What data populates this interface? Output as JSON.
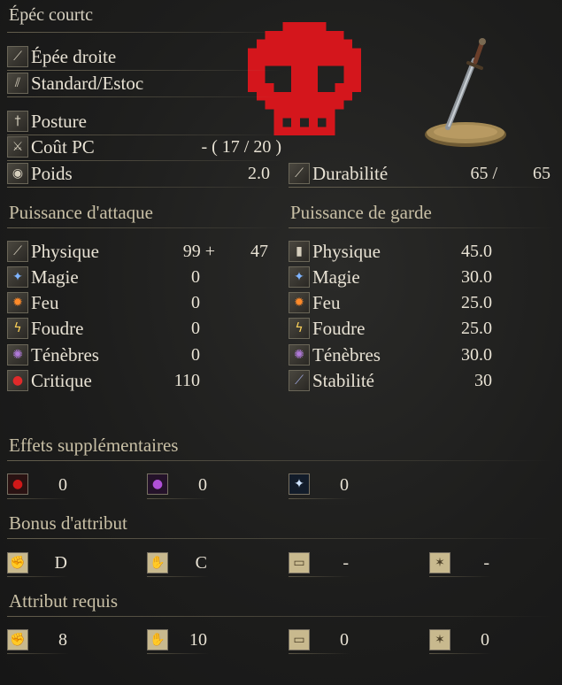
{
  "header": {
    "title": "Épéc courtc"
  },
  "weapon": {
    "type": "Épée droite",
    "attack_type": "Standard/Estoc",
    "skill_label": "Posture",
    "fp_cost_label": "Coût PC",
    "fp_cost_value": "-  (  17 /  20 )",
    "weight_label": "Poids",
    "weight_value": "2.0",
    "durability_label": "Durabilité",
    "durability_current": "65 /",
    "durability_max": "65"
  },
  "attack": {
    "heading": "Puissance d'attaque",
    "rows": [
      {
        "label": "Physique",
        "value": "99 +",
        "bonus": "47",
        "icon": "physical-attack-icon"
      },
      {
        "label": "Magie",
        "value": "0",
        "icon": "magic-icon"
      },
      {
        "label": "Feu",
        "value": "0",
        "icon": "fire-icon"
      },
      {
        "label": "Foudre",
        "value": "0",
        "icon": "lightning-icon"
      },
      {
        "label": "Ténèbres",
        "value": "0",
        "icon": "dark-icon"
      },
      {
        "label": "Critique",
        "value": "110",
        "icon": "critical-icon"
      }
    ]
  },
  "guard": {
    "heading": "Puissance de garde",
    "rows": [
      {
        "label": "Physique",
        "value": "45.0"
      },
      {
        "label": "Magie",
        "value": "30.0"
      },
      {
        "label": "Feu",
        "value": "25.0"
      },
      {
        "label": "Foudre",
        "value": "25.0"
      },
      {
        "label": "Ténèbres",
        "value": "30.0"
      },
      {
        "label": "Stabilité",
        "value": "30"
      }
    ]
  },
  "effects": {
    "heading": "Effets supplémentaires",
    "values": [
      "0",
      "0",
      "0"
    ]
  },
  "scaling": {
    "heading": "Bonus d'attribut",
    "values": [
      "D",
      "C",
      "-",
      "-"
    ]
  },
  "requirements": {
    "heading": "Attribut requis",
    "values": [
      "8",
      "10",
      "0",
      "0"
    ]
  },
  "colors": {
    "skull": "#d4161c",
    "text": "#e8e2d4",
    "heading": "#c9c0a6"
  }
}
